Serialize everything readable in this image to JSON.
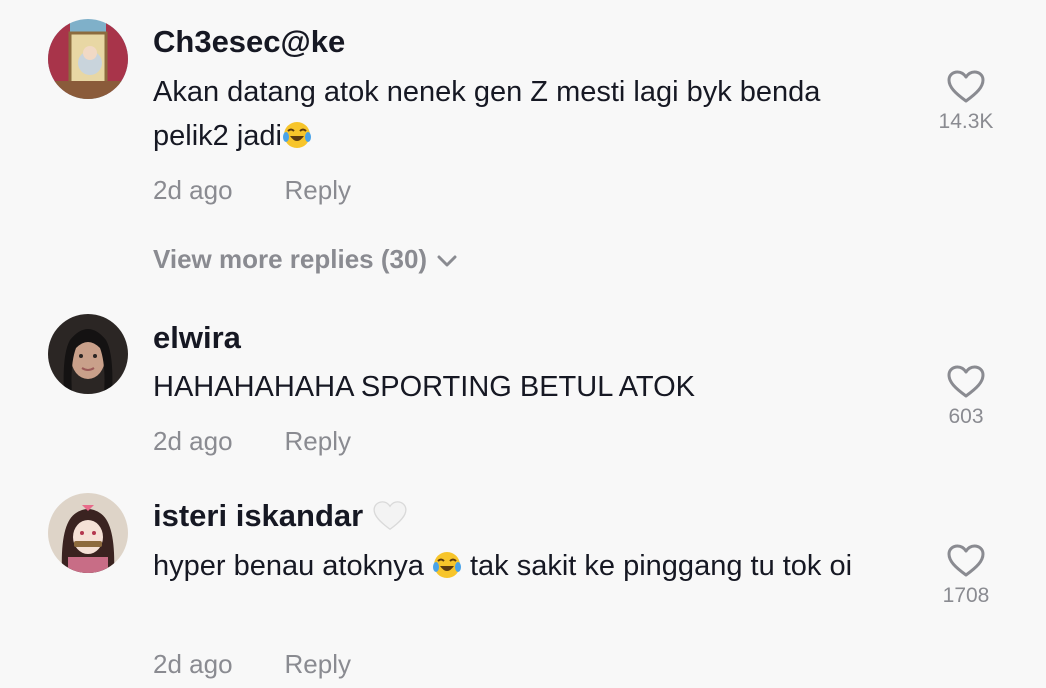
{
  "comments": [
    {
      "username": "Ch3esec@ke",
      "text_before": "Akan datang atok nenek gen Z mesti lagi byk benda pelik2 jadi",
      "text_after": "",
      "time": "2d ago",
      "reply_label": "Reply",
      "likes": "14.3K",
      "avatar_icon": "cartoon-character-avatar",
      "view_more": "View more replies (30)"
    },
    {
      "username": "elwira",
      "text_before": "HAHAHAHAHA SPORTING BETUL ATOK",
      "text_after": "",
      "time": "2d ago",
      "reply_label": "Reply",
      "likes": "603",
      "avatar_icon": "profile-photo-avatar"
    },
    {
      "username": "isteri iskandar",
      "text_before": "hyper benau atoknya ",
      "text_after": " tak sakit ke pinggang tu tok oi",
      "time": "2d ago",
      "reply_label": "Reply",
      "likes": "1708",
      "avatar_icon": "anime-character-avatar"
    }
  ],
  "colors": {
    "background": "#f8f8f8",
    "primary_text": "#161823",
    "secondary_text": "#8a8b91",
    "icon": "#8a8b91"
  }
}
